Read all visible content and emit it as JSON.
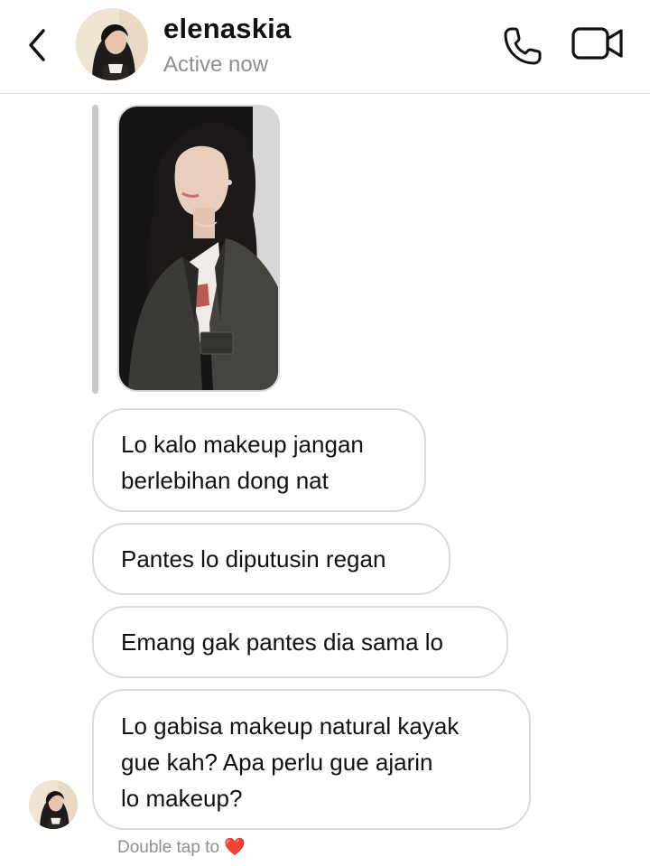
{
  "header": {
    "username": "elenaskia",
    "status": "Active now",
    "back_icon": "chevron-left-icon",
    "call_icon": "phone-icon",
    "video_icon": "video-camera-icon"
  },
  "messages": [
    {
      "lines": [
        "Lo kalo makeup jangan",
        "berlebihan dong nat"
      ]
    },
    {
      "lines": [
        "Pantes lo diputusin regan"
      ]
    },
    {
      "lines": [
        "Emang gak pantes dia sama lo"
      ]
    },
    {
      "lines": [
        "Lo gabisa makeup natural kayak",
        "gue kah? Apa perlu gue ajarin",
        "lo makeup?"
      ]
    }
  ],
  "footer": {
    "hint": "Double tap to",
    "heart": "❤️"
  },
  "colors": {
    "accent_heart": "#e8243c",
    "muted_text": "#8e8e8e",
    "bubble_border": "#dbdbdb"
  }
}
